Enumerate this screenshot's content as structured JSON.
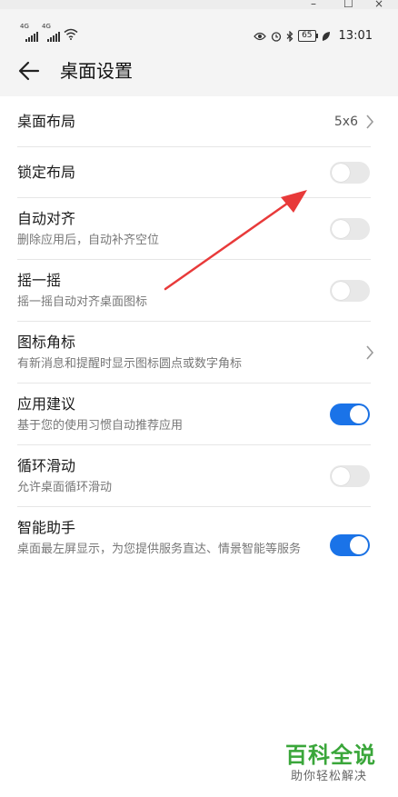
{
  "window_controls": {
    "minimize": "–",
    "maximize": "☐",
    "close": "×"
  },
  "status_bar": {
    "signal1": "4G",
    "signal2": "4G",
    "battery": "65",
    "time": "13:01"
  },
  "header": {
    "title": "桌面设置"
  },
  "settings": {
    "desktop_layout": {
      "label": "桌面布局",
      "value": "5x6"
    },
    "lock_layout": {
      "label": "锁定布局",
      "on": false
    },
    "auto_align": {
      "label": "自动对齐",
      "sub": "删除应用后，自动补齐空位",
      "on": false
    },
    "shake": {
      "label": "摇一摇",
      "sub": "摇一摇自动对齐桌面图标",
      "on": false
    },
    "icon_badge": {
      "label": "图标角标",
      "sub": "有新消息和提醒时显示图标圆点或数字角标"
    },
    "app_suggest": {
      "label": "应用建议",
      "sub": "基于您的使用习惯自动推荐应用",
      "on": true
    },
    "loop_scroll": {
      "label": "循环滑动",
      "sub": "允许桌面循环滑动",
      "on": false
    },
    "smart_assistant": {
      "label": "智能助手",
      "sub": "桌面最左屏显示，为您提供服务直达、情景智能等服务",
      "on": true
    }
  },
  "colors": {
    "toggle_on": "#1a73e8",
    "annotation_arrow": "#e83a3a",
    "watermark": "#3aa63a"
  },
  "watermark": {
    "main": "百科全说",
    "sub": "助你轻松解决"
  }
}
